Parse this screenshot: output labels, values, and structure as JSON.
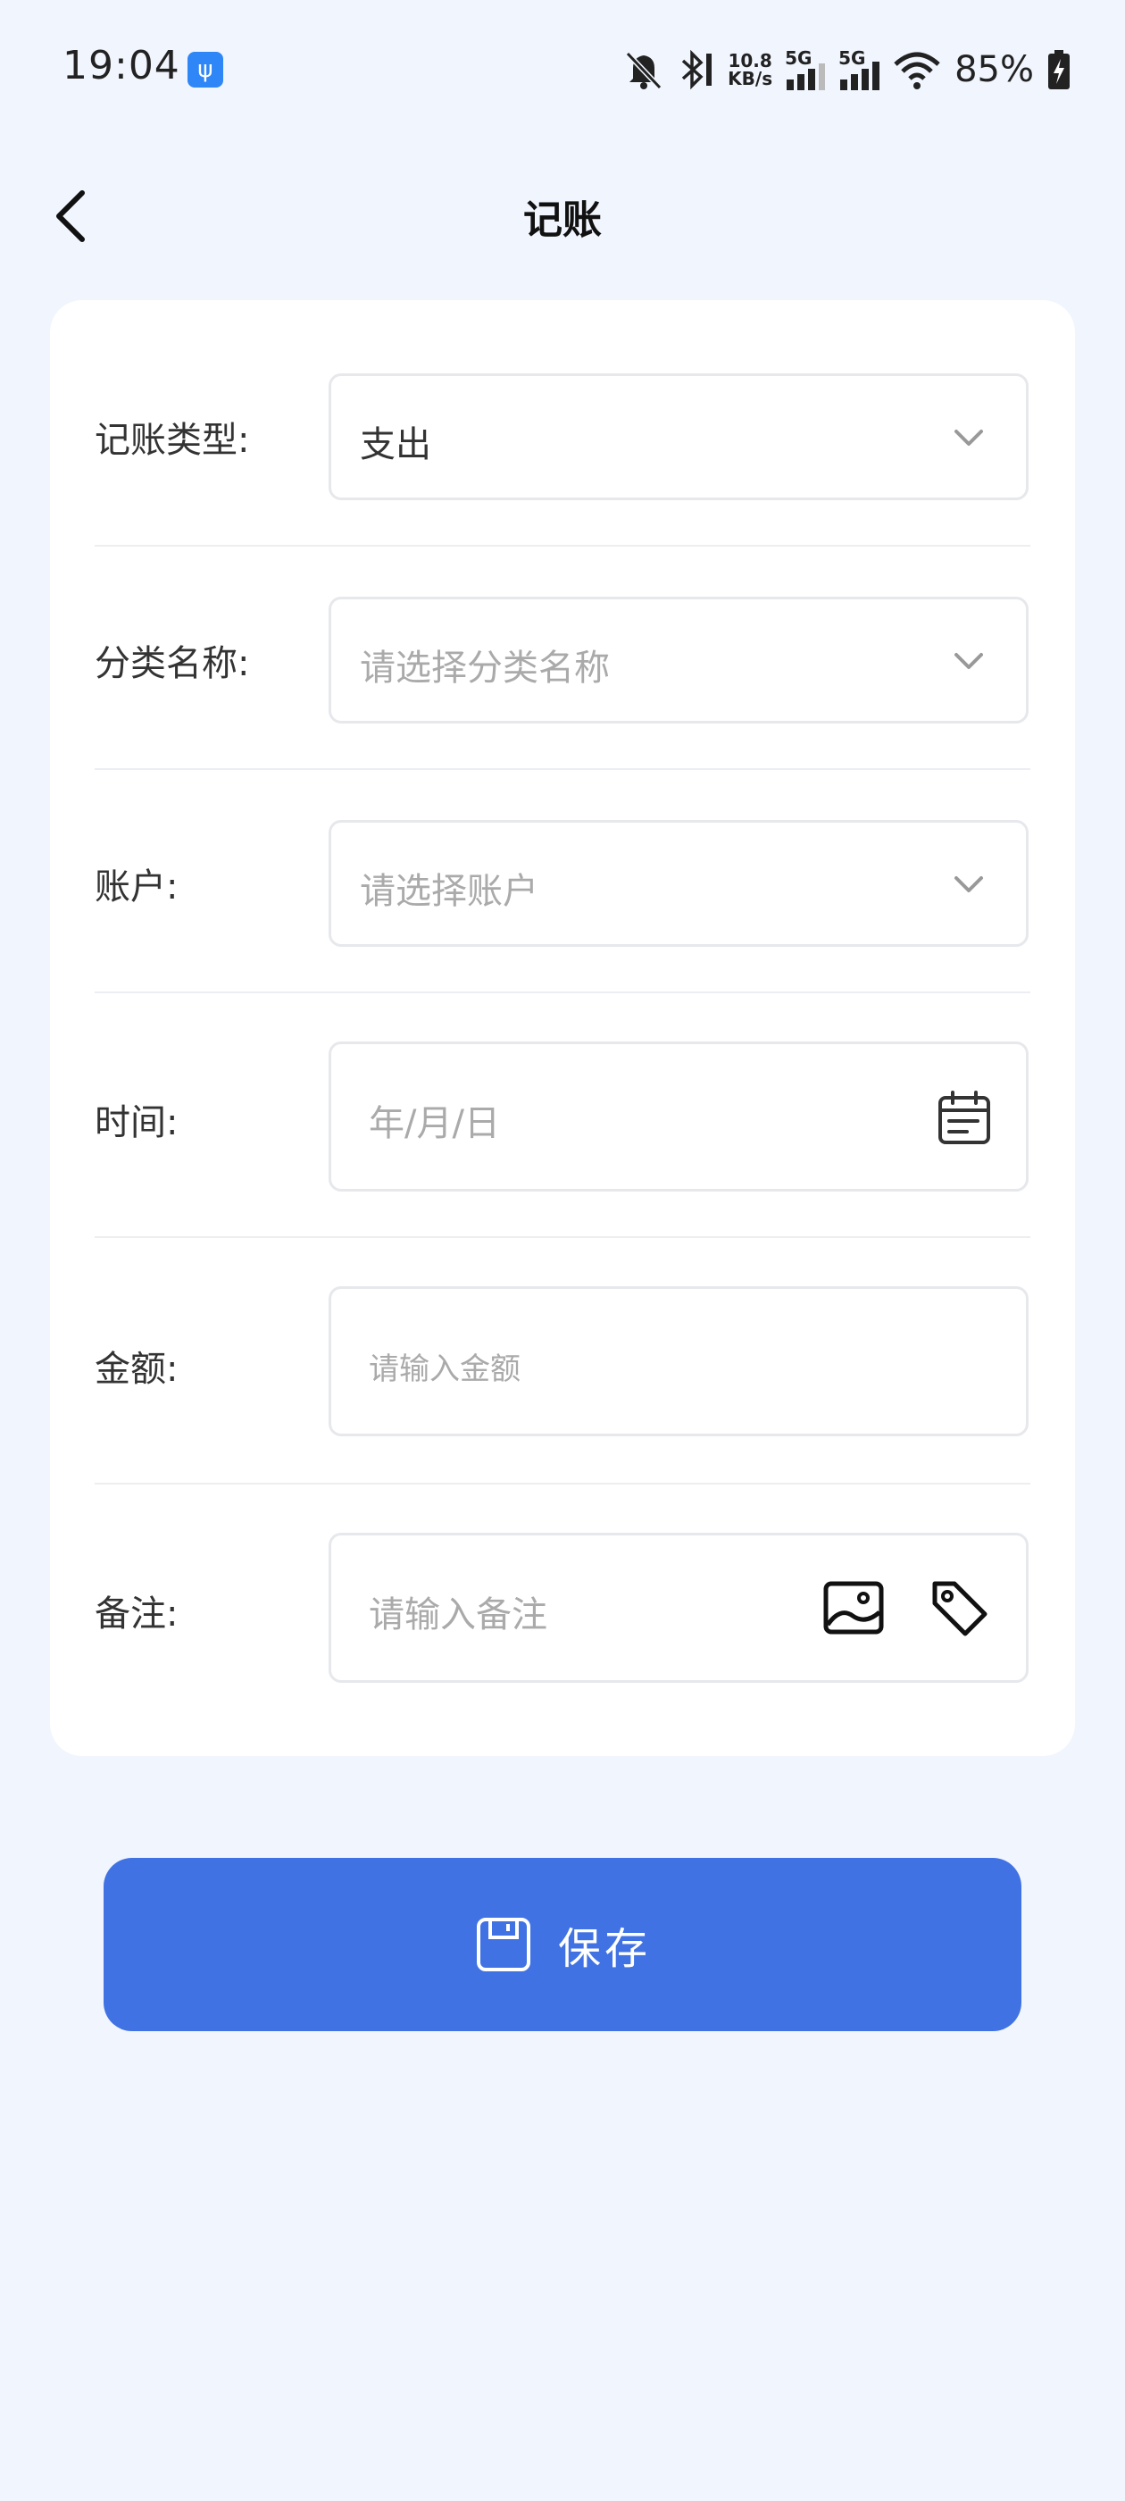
{
  "status_bar": {
    "time": "19:04",
    "network_speed_value": "10.8",
    "network_speed_unit": "KB/s",
    "sim1": "5G",
    "sim2": "5G",
    "battery": "85%"
  },
  "header": {
    "title": "记账"
  },
  "form": {
    "type": {
      "label": "记账类型:",
      "value": "支出"
    },
    "category": {
      "label": "分类名称:",
      "placeholder": "请选择分类名称"
    },
    "account": {
      "label": "账户:",
      "placeholder": "请选择账户"
    },
    "time": {
      "label": "时间:",
      "placeholder": "年/月/日"
    },
    "amount": {
      "label": "金额:",
      "placeholder": "请输入金额"
    },
    "note": {
      "label": "备注:",
      "placeholder": "请输入备注"
    }
  },
  "save": {
    "label": "保存"
  },
  "colors": {
    "accent": "#4072e4",
    "background": "#f1f5fd",
    "card": "#ffffff"
  }
}
